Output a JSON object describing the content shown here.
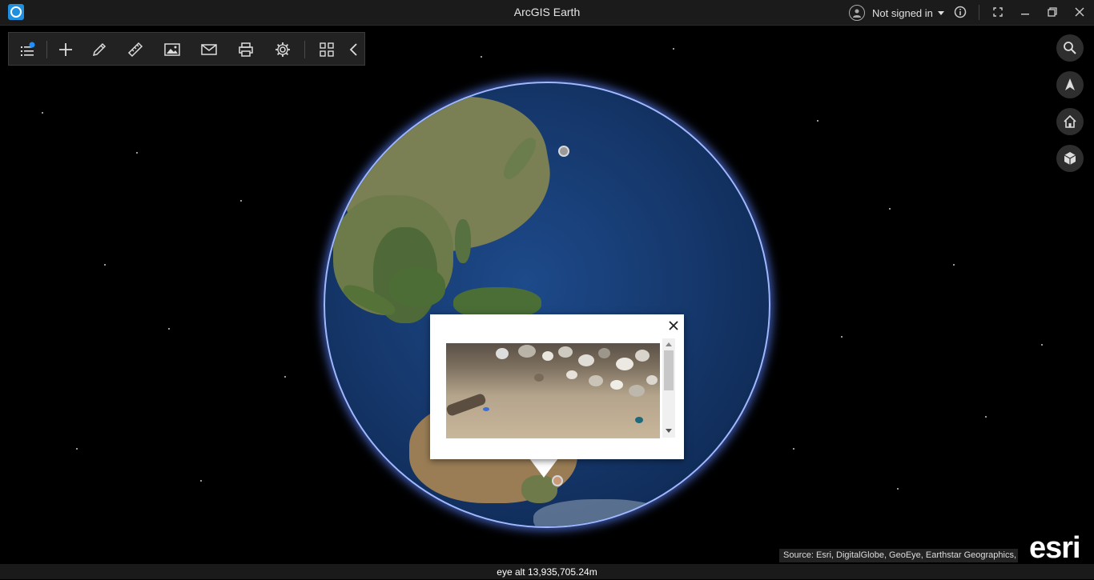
{
  "window": {
    "title": "ArcGIS Earth",
    "user_label": "Not signed in"
  },
  "toolbar": {
    "items": [
      {
        "name": "layers-icon"
      },
      {
        "name": "add-icon"
      },
      {
        "name": "draw-icon"
      },
      {
        "name": "measure-icon"
      },
      {
        "name": "image-icon"
      },
      {
        "name": "mail-icon"
      },
      {
        "name": "print-icon"
      },
      {
        "name": "settings-icon"
      },
      {
        "name": "grid-icon"
      },
      {
        "name": "collapse-icon"
      }
    ]
  },
  "nav_buttons": [
    "search-icon",
    "north-arrow-icon",
    "home-icon",
    "3d-cube-icon"
  ],
  "popup": {
    "close_icon": "close-icon"
  },
  "attribution": "Source: Esri, DigitalGlobe, GeoEye, Earthstar Geographics, ...",
  "logo": "esri",
  "status": {
    "eye_altitude": "eye alt 13,935,705.24m"
  },
  "colors": {
    "accent": "#1f8fe0",
    "notification_dot": "#1e90ff",
    "globe_halo": "#9fb8ff"
  }
}
